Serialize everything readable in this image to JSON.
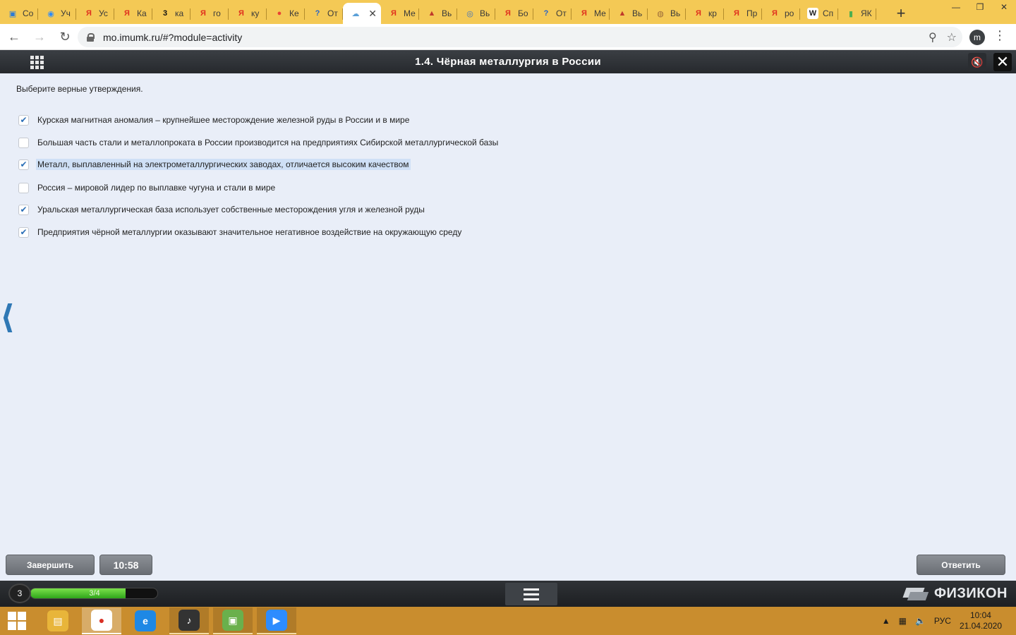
{
  "browser": {
    "tabs": [
      {
        "label": "Со",
        "color": "#2d7bd6",
        "glyph": "▣"
      },
      {
        "label": "Уч",
        "color": "#2d8cff",
        "glyph": "◉"
      },
      {
        "label": "Ус",
        "color": "#e0301e",
        "glyph": "Я"
      },
      {
        "label": "Ка",
        "color": "#e0301e",
        "glyph": "Я"
      },
      {
        "label": "ка",
        "color": "#111111",
        "glyph": "3"
      },
      {
        "label": "го",
        "color": "#e0301e",
        "glyph": "Я"
      },
      {
        "label": "ку",
        "color": "#e0301e",
        "glyph": "Я"
      },
      {
        "label": "Ке",
        "color": "#e94234",
        "glyph": "●"
      },
      {
        "label": "От",
        "color": "#2563c9",
        "glyph": "?"
      },
      {
        "label": "",
        "color": "#5aa0d8",
        "glyph": "☁",
        "active": true
      },
      {
        "label": "Ме",
        "color": "#e0301e",
        "glyph": "Я"
      },
      {
        "label": "Вь",
        "color": "#c0392b",
        "glyph": "▲"
      },
      {
        "label": "Вь",
        "color": "#3a6fc2",
        "glyph": "◎"
      },
      {
        "label": "Бо",
        "color": "#e0301e",
        "glyph": "Я"
      },
      {
        "label": "От",
        "color": "#2563c9",
        "glyph": "?"
      },
      {
        "label": "Ме",
        "color": "#e0301e",
        "glyph": "Я"
      },
      {
        "label": "Вь",
        "color": "#c0392b",
        "glyph": "▲"
      },
      {
        "label": "Вь",
        "color": "#9a6a3a",
        "glyph": "◍"
      },
      {
        "label": "кр",
        "color": "#e0301e",
        "glyph": "Я"
      },
      {
        "label": "Пр",
        "color": "#e0301e",
        "glyph": "Я"
      },
      {
        "label": "ро",
        "color": "#e0301e",
        "glyph": "Я"
      },
      {
        "label": "Сп",
        "color": "#ffffff",
        "glyph": "W"
      },
      {
        "label": "ЯК",
        "color": "#4caf50",
        "glyph": "▮"
      }
    ],
    "close_tab": "✕",
    "new_tab": "+",
    "window_controls": [
      "—",
      "❐",
      "✕"
    ],
    "url": "mo.imumk.ru/#?module=activity",
    "profile_initial": "m"
  },
  "app": {
    "title": "1.4. Чёрная металлургия в России",
    "instruction": "Выберите верные утверждения.",
    "options": [
      {
        "text": "Курская магнитная аномалия – крупнейшее месторождение железной руды в России и в мире",
        "checked": true
      },
      {
        "text": "Большая часть стали и металлопроката в России производится на предприятиях Сибирской металлургической базы",
        "checked": false
      },
      {
        "text": "Металл, выплавленный на электрометаллургических заводах, отличается высоким качеством",
        "checked": true,
        "highlighted": true
      },
      {
        "text": "Россия – мировой лидер по выплавке чугуна и стали в мире",
        "checked": false
      },
      {
        "text": "Уральская металлургическая база использует собственные месторождения угля и железной руды",
        "checked": true
      },
      {
        "text": "Предприятия чёрной металлургии оказывают значительное негативное воздействие на окружающую среду",
        "checked": true
      }
    ],
    "finish_label": "Завершить",
    "timer": "10:58",
    "answer_label": "Ответить",
    "level": "3",
    "progress_label": "3/4",
    "progress_fraction": 0.75,
    "brand": "ФИЗИКОН",
    "back_arrow": "⟨"
  },
  "taskbar": {
    "apps": [
      {
        "name": "file-explorer",
        "color": "#e8b53a",
        "glyph": "▤",
        "state": ""
      },
      {
        "name": "chrome",
        "color": "#ffffff",
        "glyph": "●",
        "state": "active"
      },
      {
        "name": "internet-explorer",
        "color": "#1e88e5",
        "glyph": "e",
        "state": ""
      },
      {
        "name": "fl-studio",
        "color": "#333333",
        "glyph": "♪",
        "state": "running"
      },
      {
        "name": "android-app",
        "color": "#6ab04c",
        "glyph": "▣",
        "state": "running"
      },
      {
        "name": "zoom",
        "color": "#2d8cff",
        "glyph": "▶",
        "state": "running"
      }
    ],
    "lang": "РУС",
    "time": "10:04",
    "date": "21.04.2020"
  }
}
